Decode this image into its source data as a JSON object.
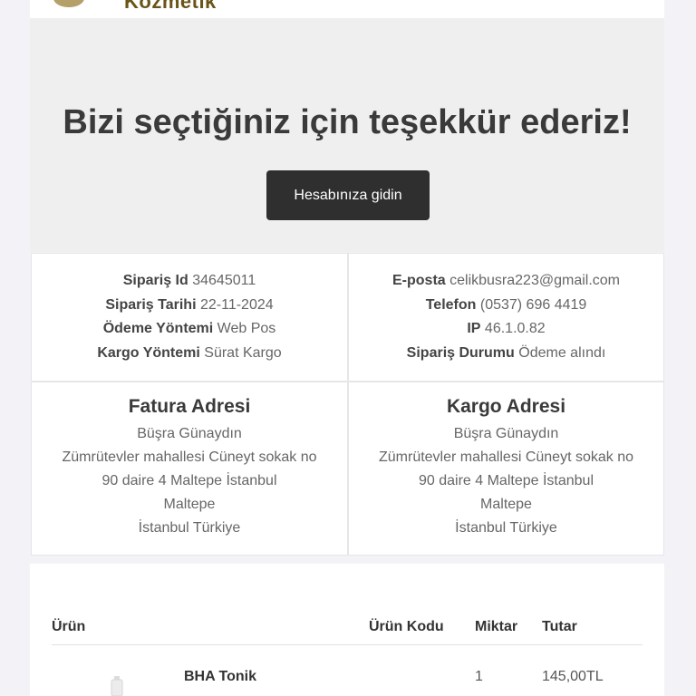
{
  "header": {
    "logo_text": "Kozmetik"
  },
  "hero": {
    "title": "Bizi seçtiğiniz için teşekkür ederiz!",
    "button_label": "Hesabınıza gidin"
  },
  "order_info": {
    "order_id_label": "Sipariş Id",
    "order_id": "34645011",
    "order_date_label": "Sipariş Tarihi",
    "order_date": "22-11-2024",
    "payment_label": "Ödeme Yöntemi",
    "payment": "Web Pos",
    "shipping_label": "Kargo Yöntemi",
    "shipping": "Sürat Kargo",
    "email_label": "E-posta",
    "email": "celikbusra223@gmail.com",
    "phone_label": "Telefon",
    "phone": "(0537) 696 4419",
    "ip_label": "IP",
    "ip": "46.1.0.82",
    "status_label": "Sipariş Durumu",
    "status": "Ödeme alındı"
  },
  "billing": {
    "title": "Fatura Adresi",
    "name": "Büşra Günaydın",
    "address_1": "Zümrütevler mahallesi Cüneyt sokak no",
    "address_2": "90 daire 4 Maltepe İstanbul",
    "district": "Maltepe",
    "city_country": "İstanbul Türkiye"
  },
  "shipping_address": {
    "title": "Kargo Adresi",
    "name": "Büşra Günaydın",
    "address_1": "Zümrütevler mahallesi Cüneyt sokak no",
    "address_2": "90 daire 4 Maltepe İstanbul",
    "district": "Maltepe",
    "city_country": "İstanbul Türkiye"
  },
  "products": {
    "headers": {
      "product": "Ürün",
      "code": "Ürün Kodu",
      "qty": "Miktar",
      "total": "Tutar"
    },
    "rows": [
      {
        "name": "BHA Tonik",
        "code": "",
        "qty": "1",
        "total": "145,00TL"
      }
    ]
  }
}
